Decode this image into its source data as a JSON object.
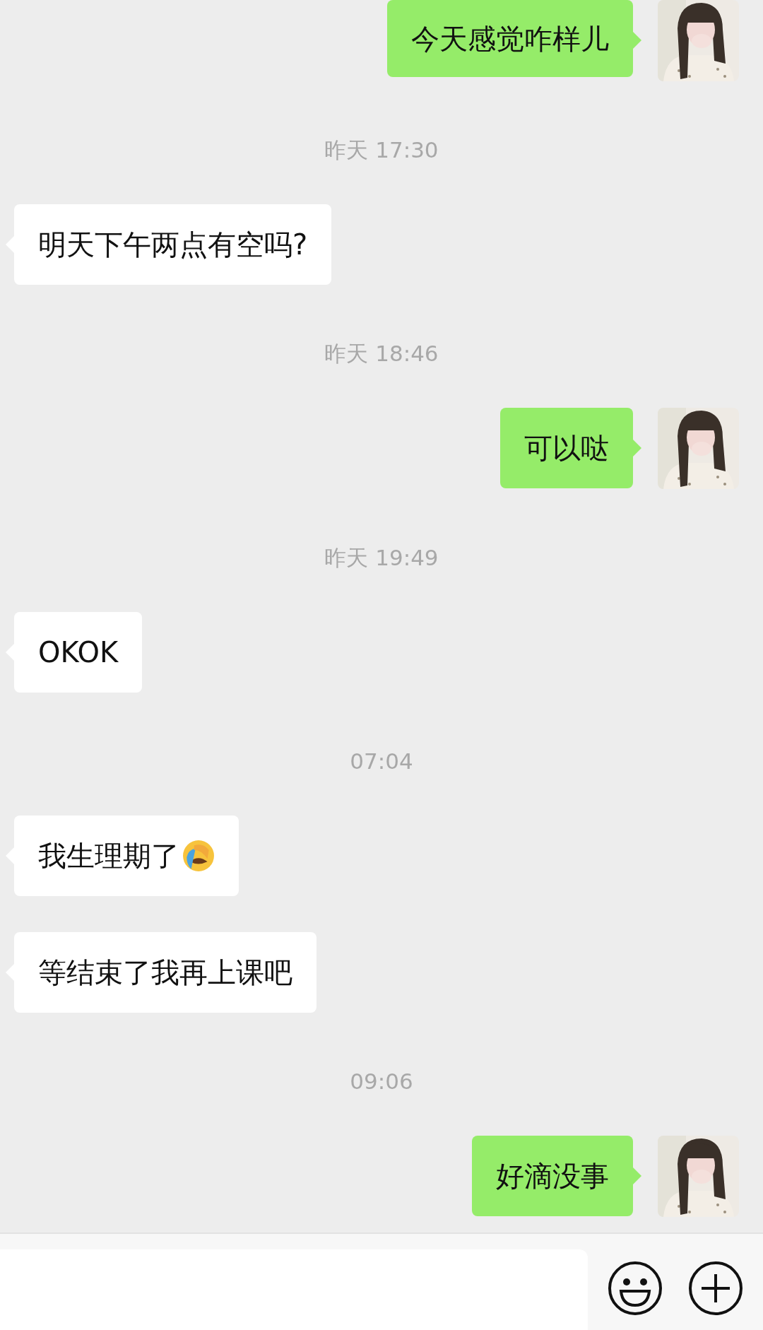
{
  "messages": [
    {
      "kind": "out",
      "text": "今天感觉咋样儿",
      "emoji": false
    },
    {
      "kind": "time",
      "text": "昨天 17:30"
    },
    {
      "kind": "in",
      "text": "明天下午两点有空吗?",
      "emoji": false
    },
    {
      "kind": "time",
      "text": "昨天 18:46"
    },
    {
      "kind": "out",
      "text": "可以哒",
      "emoji": false
    },
    {
      "kind": "time",
      "text": "昨天 19:49"
    },
    {
      "kind": "in",
      "text": "OKOK",
      "emoji": false
    },
    {
      "kind": "time",
      "text": "07:04"
    },
    {
      "kind": "in",
      "text": "我生理期了",
      "emoji": true
    },
    {
      "kind": "in",
      "text": "等结束了我再上课吧",
      "emoji": false
    },
    {
      "kind": "time",
      "text": "09:06"
    },
    {
      "kind": "out",
      "text": "好滴没事",
      "emoji": false
    }
  ]
}
